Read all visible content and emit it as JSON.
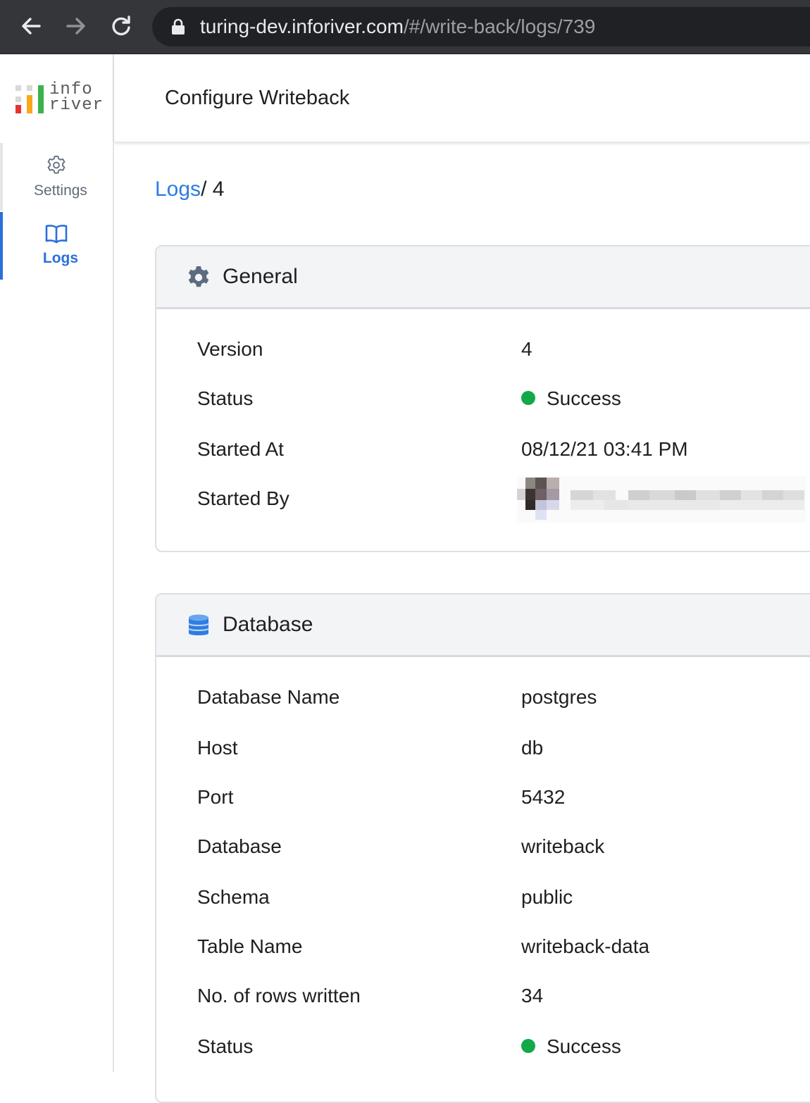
{
  "browser": {
    "url_host": "turing-dev.inforiver.com",
    "url_path": "/#/write-back/logs/739",
    "back_icon": "arrow-left-icon",
    "forward_icon": "arrow-right-icon",
    "reload_icon": "reload-icon",
    "lock_icon": "lock-icon"
  },
  "logo": {
    "line1": "info",
    "line2": "river"
  },
  "header": {
    "title": "Configure Writeback"
  },
  "sidebar": {
    "items": [
      {
        "label": "Settings",
        "icon": "gear-icon",
        "active": false
      },
      {
        "label": "Logs",
        "icon": "book-icon",
        "active": true
      }
    ]
  },
  "breadcrumb": {
    "link": "Logs",
    "separator": "/",
    "current": " 4"
  },
  "general": {
    "title": "General",
    "icon": "gear-icon",
    "rows": [
      {
        "label": "Version",
        "value": "4"
      },
      {
        "label": "Status",
        "value": "Success",
        "status": "success"
      },
      {
        "label": "Started At",
        "value": "08/12/21 03:41 PM"
      },
      {
        "label": "Started By",
        "value": "",
        "redacted": true
      }
    ]
  },
  "database": {
    "title": "Database",
    "icon": "database-icon",
    "rows": [
      {
        "label": "Database Name",
        "value": "postgres"
      },
      {
        "label": "Host",
        "value": "db"
      },
      {
        "label": "Port",
        "value": "5432"
      },
      {
        "label": "Database",
        "value": "writeback"
      },
      {
        "label": "Schema",
        "value": "public"
      },
      {
        "label": "Table Name",
        "value": "writeback-data"
      },
      {
        "label": "No. of rows written",
        "value": "34"
      },
      {
        "label": "Status",
        "value": "Success",
        "status": "success"
      }
    ]
  },
  "colors": {
    "accent": "#2a7de1",
    "success": "#14a948",
    "chrome_bg": "#35363a"
  }
}
